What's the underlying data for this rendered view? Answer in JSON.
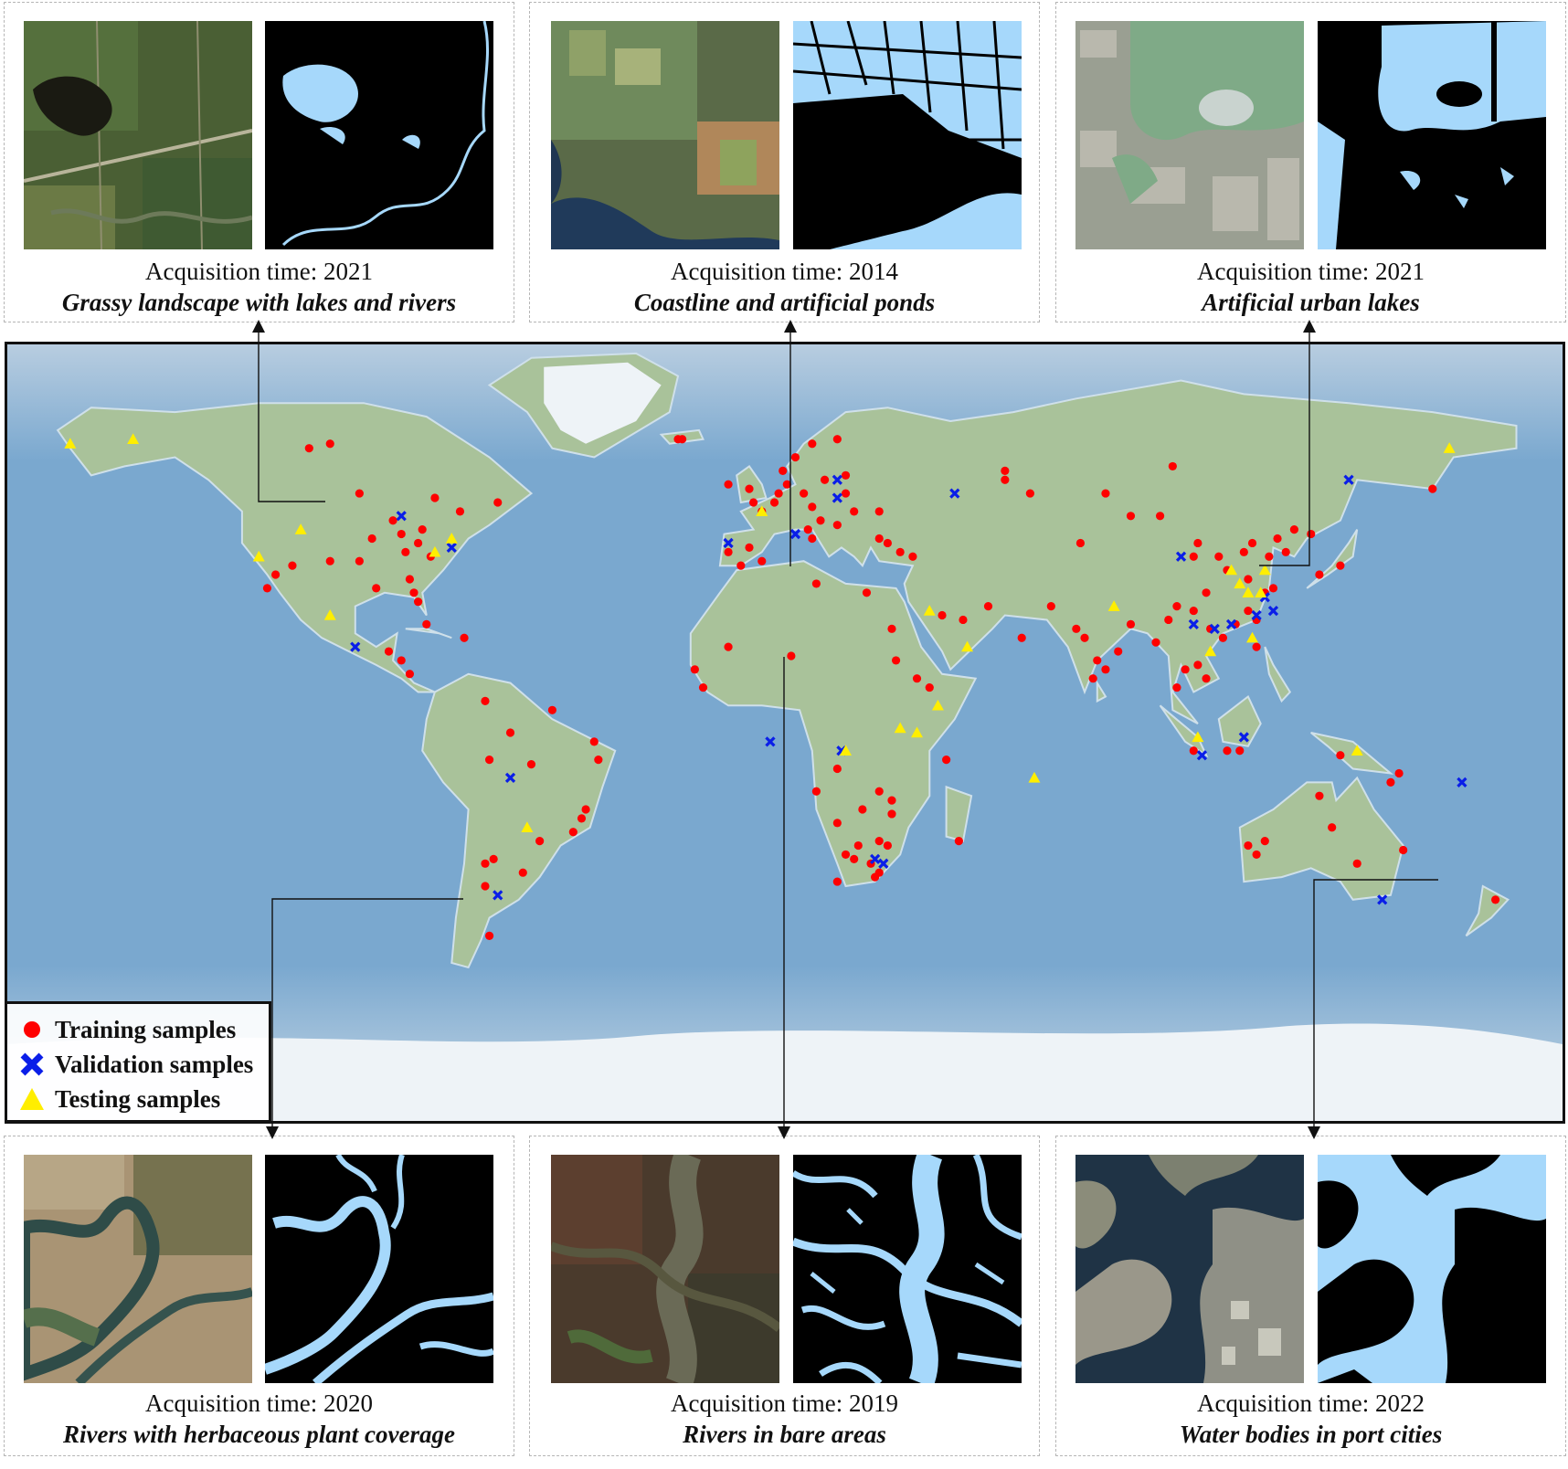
{
  "panels": [
    {
      "id": "grassy",
      "time": "Acquisition time: 2021",
      "desc": "Grassy landscape with lakes and rivers"
    },
    {
      "id": "coast",
      "time": "Acquisition time: 2014",
      "desc": "Coastline and artificial ponds"
    },
    {
      "id": "urban",
      "time": "Acquisition time: 2021",
      "desc": "Artificial urban lakes"
    },
    {
      "id": "herb",
      "time": "Acquisition time: 2020",
      "desc": "Rivers with herbaceous plant coverage"
    },
    {
      "id": "bare",
      "time": "Acquisition time: 2019",
      "desc": "Rivers in bare areas"
    },
    {
      "id": "port",
      "time": "Acquisition time: 2022",
      "desc": "Water bodies in port cities"
    }
  ],
  "legend": {
    "training": "Training samples",
    "validation": "Validation samples",
    "testing": "Testing samples"
  },
  "colors": {
    "training": "#ff0000",
    "validation": "#0a1ee8",
    "testing": "#ffee00",
    "water_mask": "#a6d8fb",
    "ocean": "#7aa8cf",
    "land": "#a9c29a"
  },
  "samples": {
    "training": [
      [
        -96,
        52
      ],
      [
        -103,
        63
      ],
      [
        -108,
        62
      ],
      [
        -78,
        51
      ],
      [
        -88,
        46
      ],
      [
        -81,
        44
      ],
      [
        -86,
        43
      ],
      [
        -82,
        41
      ],
      [
        -85,
        39
      ],
      [
        -79,
        38
      ],
      [
        -93,
        42
      ],
      [
        -96,
        37
      ],
      [
        -103,
        37
      ],
      [
        -112,
        36
      ],
      [
        -116,
        34
      ],
      [
        -118,
        31
      ],
      [
        -92,
        31
      ],
      [
        -84,
        33
      ],
      [
        -83,
        30
      ],
      [
        -82,
        28
      ],
      [
        -80,
        23
      ],
      [
        -71,
        20
      ],
      [
        -86,
        15
      ],
      [
        -89,
        17
      ],
      [
        -84,
        12
      ],
      [
        -72,
        48
      ],
      [
        -63,
        50
      ],
      [
        -66,
        6
      ],
      [
        -50,
        4
      ],
      [
        -60,
        -1
      ],
      [
        -40,
        -3
      ],
      [
        -39,
        -7
      ],
      [
        -65,
        -7
      ],
      [
        -55,
        -8
      ],
      [
        -42,
        -18
      ],
      [
        -43,
        -20
      ],
      [
        -45,
        -23
      ],
      [
        -53,
        -25
      ],
      [
        -64,
        -29
      ],
      [
        -66,
        -30
      ],
      [
        -57,
        -32
      ],
      [
        -66,
        -35
      ],
      [
        -65,
        -46
      ],
      [
        -19,
        64
      ],
      [
        -20,
        64
      ],
      [
        -8,
        54
      ],
      [
        -3,
        53
      ],
      [
        -2,
        50
      ],
      [
        0,
        48
      ],
      [
        3,
        50
      ],
      [
        4,
        52
      ],
      [
        6,
        54
      ],
      [
        5,
        57
      ],
      [
        8,
        60
      ],
      [
        12,
        63
      ],
      [
        18,
        64
      ],
      [
        20,
        56
      ],
      [
        15,
        55
      ],
      [
        10,
        52
      ],
      [
        12,
        49
      ],
      [
        14,
        46
      ],
      [
        11,
        44
      ],
      [
        12,
        42
      ],
      [
        18,
        45
      ],
      [
        22,
        48
      ],
      [
        20,
        52
      ],
      [
        28,
        48
      ],
      [
        28,
        42
      ],
      [
        30,
        41
      ],
      [
        33,
        39
      ],
      [
        36,
        38
      ],
      [
        -5,
        36
      ],
      [
        -8,
        39
      ],
      [
        -3,
        40
      ],
      [
        0,
        37
      ],
      [
        13,
        32
      ],
      [
        25,
        30
      ],
      [
        31,
        22
      ],
      [
        32,
        15
      ],
      [
        37,
        11
      ],
      [
        40,
        9
      ],
      [
        7,
        16
      ],
      [
        -16,
        13
      ],
      [
        -14,
        9
      ],
      [
        -8,
        18
      ],
      [
        43,
        25
      ],
      [
        48,
        24
      ],
      [
        54,
        27
      ],
      [
        62,
        20
      ],
      [
        69,
        27
      ],
      [
        75,
        22
      ],
      [
        77,
        20
      ],
      [
        80,
        15
      ],
      [
        79,
        11
      ],
      [
        82,
        13
      ],
      [
        85,
        17
      ],
      [
        88,
        23
      ],
      [
        94,
        19
      ],
      [
        97,
        24
      ],
      [
        99,
        27
      ],
      [
        103,
        26
      ],
      [
        106,
        30
      ],
      [
        107,
        22
      ],
      [
        110,
        20
      ],
      [
        113,
        23
      ],
      [
        116,
        26
      ],
      [
        118,
        24
      ],
      [
        120,
        30
      ],
      [
        122,
        31
      ],
      [
        116,
        33
      ],
      [
        111,
        35
      ],
      [
        109,
        38
      ],
      [
        115,
        39
      ],
      [
        117,
        41
      ],
      [
        121,
        38
      ],
      [
        127,
        44
      ],
      [
        131,
        43
      ],
      [
        138,
        36
      ],
      [
        133,
        34
      ],
      [
        125,
        39
      ],
      [
        123,
        42
      ],
      [
        95,
        47
      ],
      [
        88,
        47
      ],
      [
        82,
        52
      ],
      [
        76,
        41
      ],
      [
        64,
        52
      ],
      [
        58,
        55
      ],
      [
        58,
        57
      ],
      [
        98,
        58
      ],
      [
        104,
        41
      ],
      [
        103,
        38
      ],
      [
        106,
        11
      ],
      [
        104,
        14
      ],
      [
        101,
        13
      ],
      [
        99,
        9
      ],
      [
        114,
        -5
      ],
      [
        111,
        -5
      ],
      [
        133,
        -15
      ],
      [
        138,
        -6
      ],
      [
        136,
        -22
      ],
      [
        118,
        -28
      ],
      [
        116,
        -26
      ],
      [
        120,
        -25
      ],
      [
        142,
        -30
      ],
      [
        153,
        -27
      ],
      [
        175,
        -38
      ],
      [
        152,
        -10
      ],
      [
        103,
        -5
      ],
      [
        18,
        -21
      ],
      [
        24,
        -18
      ],
      [
        28,
        -14
      ],
      [
        23,
        -26
      ],
      [
        20,
        -28
      ],
      [
        22,
        -29
      ],
      [
        27,
        -33
      ],
      [
        26,
        -30
      ],
      [
        28,
        -32
      ],
      [
        18,
        -34
      ],
      [
        30,
        -26
      ],
      [
        28,
        -25
      ],
      [
        47,
        -25
      ],
      [
        31,
        -19
      ],
      [
        31,
        -16
      ],
      [
        44,
        -7
      ],
      [
        13,
        -14
      ],
      [
        18,
        -9
      ],
      [
        160,
        53
      ],
      [
        118,
        18
      ],
      [
        150,
        -12
      ]
    ],
    "validation": [
      [
        -86,
        47
      ],
      [
        -74,
        40
      ],
      [
        -97,
        18
      ],
      [
        -60,
        -11
      ],
      [
        -63,
        -37
      ],
      [
        -8,
        41
      ],
      [
        8,
        43
      ],
      [
        18,
        55
      ],
      [
        18,
        51
      ],
      [
        46,
        52
      ],
      [
        100,
        38
      ],
      [
        103,
        23
      ],
      [
        108,
        22
      ],
      [
        118,
        25
      ],
      [
        120,
        29
      ],
      [
        122,
        26
      ],
      [
        115,
        -2
      ],
      [
        105,
        -6
      ],
      [
        112,
        23
      ],
      [
        140,
        55
      ],
      [
        167,
        -12
      ],
      [
        148,
        -38
      ],
      [
        2,
        -3
      ],
      [
        19,
        -5
      ],
      [
        27,
        -29
      ],
      [
        29,
        -30
      ]
    ],
    "testing": [
      [
        -165,
        63
      ],
      [
        -150,
        64
      ],
      [
        -110,
        44
      ],
      [
        -74,
        42
      ],
      [
        -78,
        39
      ],
      [
        -120,
        38
      ],
      [
        -103,
        25
      ],
      [
        -56,
        -22
      ],
      [
        0,
        48
      ],
      [
        40,
        26
      ],
      [
        49,
        18
      ],
      [
        65,
        -11
      ],
      [
        42,
        5
      ],
      [
        33,
        0
      ],
      [
        37,
        -1
      ],
      [
        20,
        -5
      ],
      [
        84,
        27
      ],
      [
        112,
        35
      ],
      [
        114,
        32
      ],
      [
        116,
        30
      ],
      [
        119,
        30
      ],
      [
        120,
        35
      ],
      [
        117,
        20
      ],
      [
        107,
        17
      ],
      [
        104,
        -2
      ],
      [
        142,
        -5
      ],
      [
        164,
        62
      ]
    ]
  }
}
